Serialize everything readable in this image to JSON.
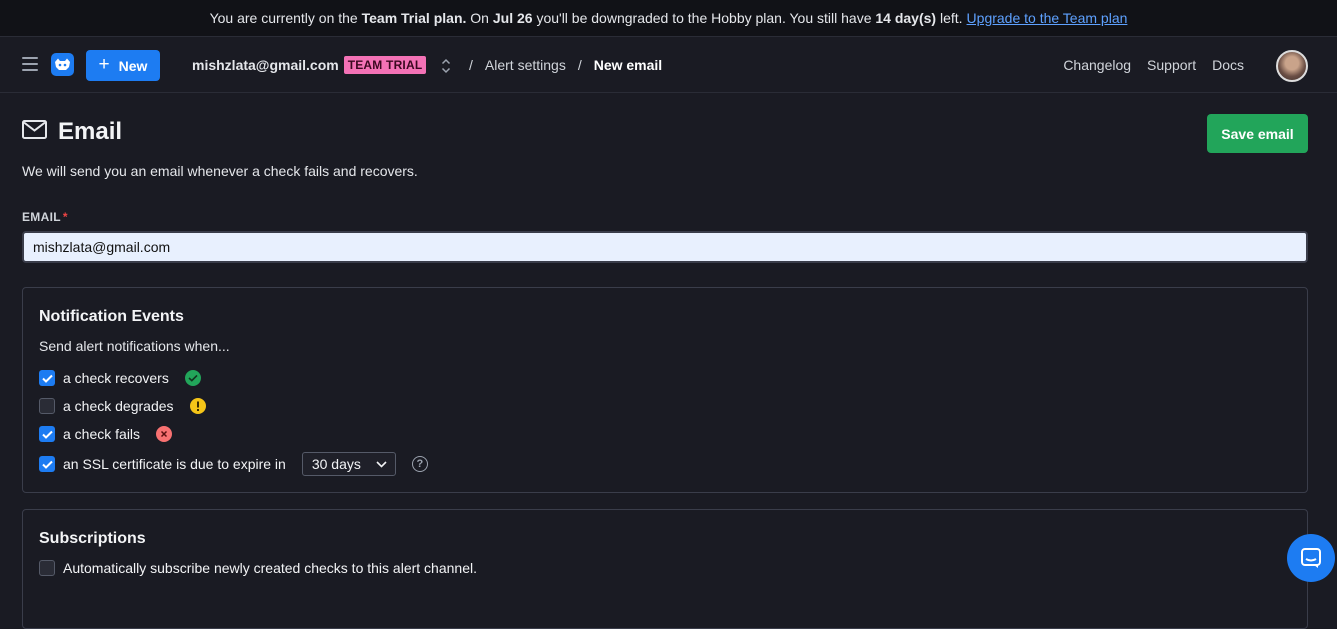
{
  "banner": {
    "prefix": "You are currently on the",
    "plan": "Team Trial plan.",
    "on": "On",
    "date": "Jul 26",
    "middle": "you'll be downgraded to the Hobby plan. You still have",
    "days": "14 day(s)",
    "left": "left.",
    "upgrade_link": "Upgrade to the Team plan"
  },
  "nav": {
    "new_label": "New",
    "account_email": "mishzlata@gmail.com",
    "account_badge": "TEAM TRIAL",
    "breadcrumb": {
      "sep": "/",
      "alert_settings": "Alert settings",
      "current": "New email"
    },
    "links": {
      "changelog": "Changelog",
      "support": "Support",
      "docs": "Docs"
    }
  },
  "page": {
    "title": "Email",
    "save_label": "Save email",
    "description": "We will send you an email whenever a check fails and recovers.",
    "email_label": "EMAIL",
    "email_required_mark": "*",
    "email_value": "mishzlata@gmail.com"
  },
  "notifications": {
    "title": "Notification Events",
    "subtitle": "Send alert notifications when...",
    "items": [
      {
        "label": "a check recovers",
        "checked": true
      },
      {
        "label": "a check degrades",
        "checked": false
      },
      {
        "label": "a check fails",
        "checked": true
      },
      {
        "label": "an SSL certificate is due to expire in",
        "checked": true
      }
    ],
    "ssl_days": "30 days"
  },
  "subscriptions": {
    "title": "Subscriptions",
    "auto_subscribe_label": "Automatically subscribe newly created checks to this alert channel.",
    "auto_subscribe_checked": false
  },
  "colors": {
    "accent": "#1d7cf2",
    "save": "#22a55a",
    "badge": "#f472b6",
    "ok": "#22a55a",
    "warn": "#f5c518",
    "fail": "#f87171"
  }
}
